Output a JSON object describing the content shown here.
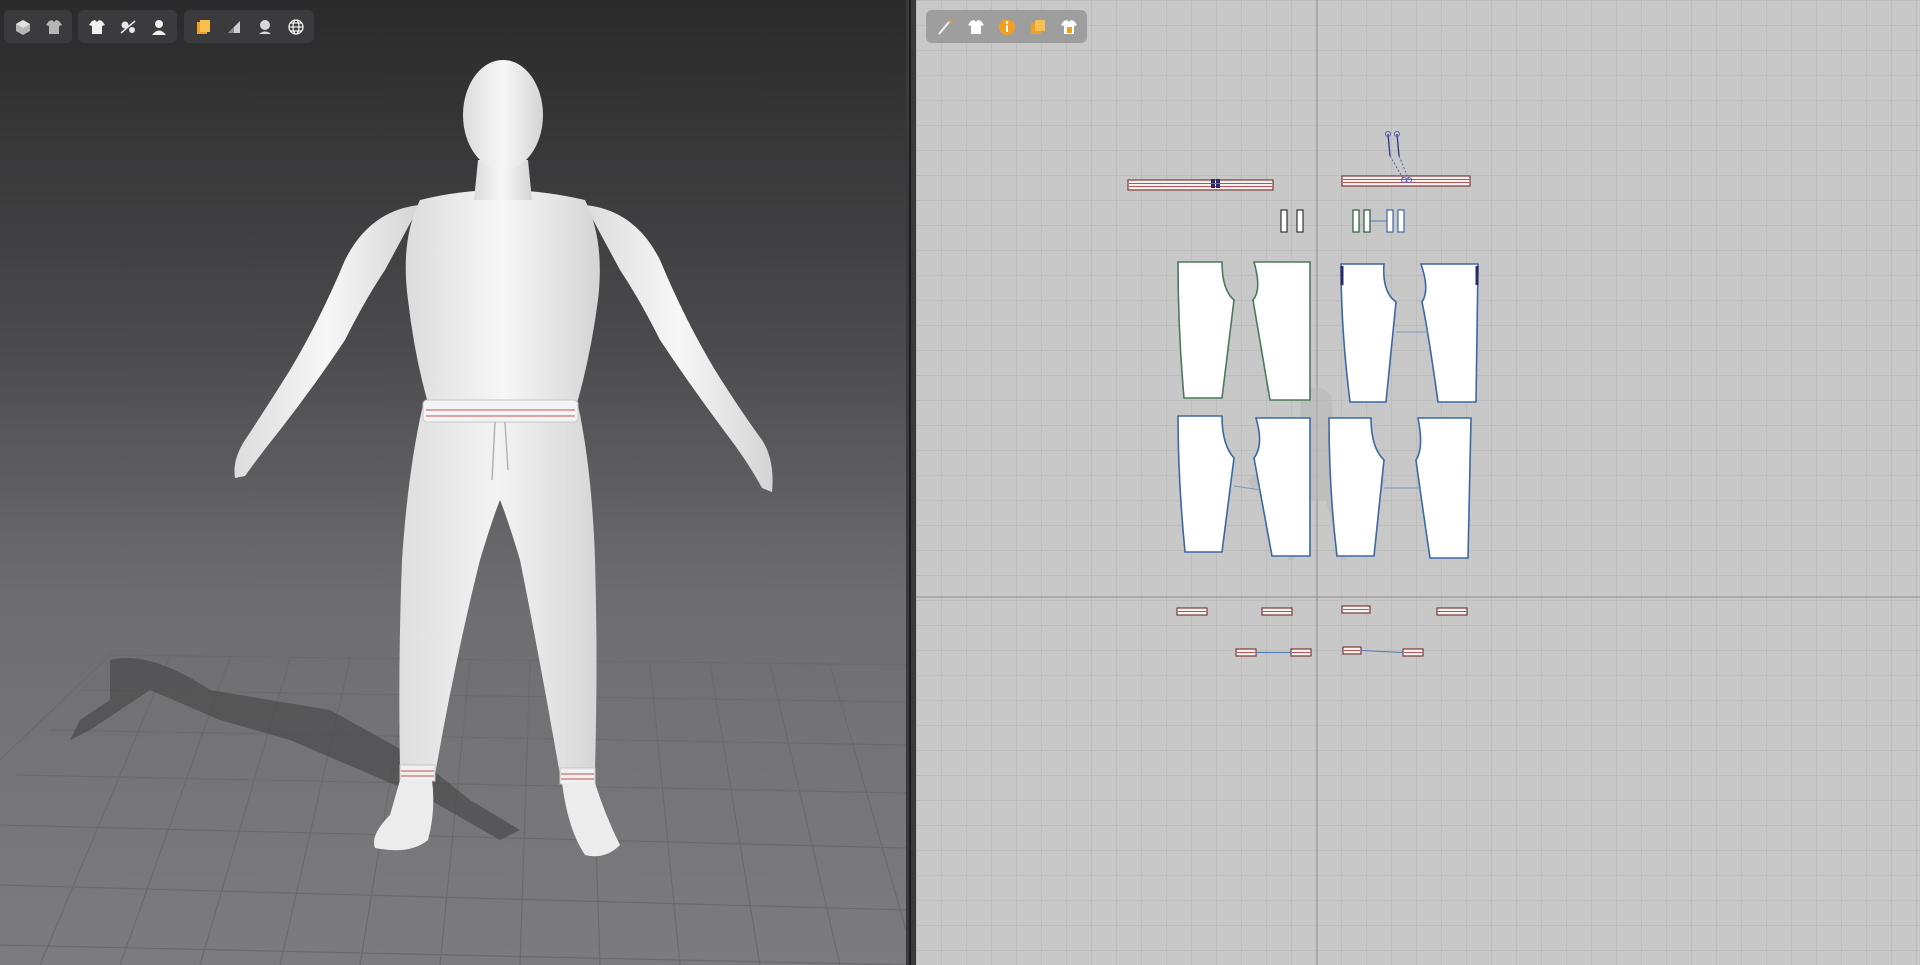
{
  "viewport_3d": {
    "toolbar_groups": [
      [
        {
          "icon": "avatar-display-icon"
        },
        {
          "icon": "garment-display-icon"
        }
      ],
      [
        {
          "icon": "shirt-icon"
        },
        {
          "icon": "avatar-measure-icon"
        },
        {
          "icon": "avatar-icon"
        }
      ],
      [
        {
          "icon": "texture-icon"
        },
        {
          "icon": "shading-icon"
        },
        {
          "icon": "render-sphere-icon"
        },
        {
          "icon": "globe-icon"
        }
      ]
    ]
  },
  "viewport_2d": {
    "toolbar": [
      {
        "icon": "brush-tool-icon"
      },
      {
        "icon": "shirt-icon"
      },
      {
        "icon": "info-icon"
      },
      {
        "icon": "texture-layer-icon"
      },
      {
        "icon": "garment-home-icon"
      }
    ]
  },
  "colors": {
    "accent_orange": "#f0a020",
    "pattern_outline_blue": "#3a68a8",
    "pattern_outline_green": "#4a7a5a",
    "stitch_red": "#c05050"
  }
}
